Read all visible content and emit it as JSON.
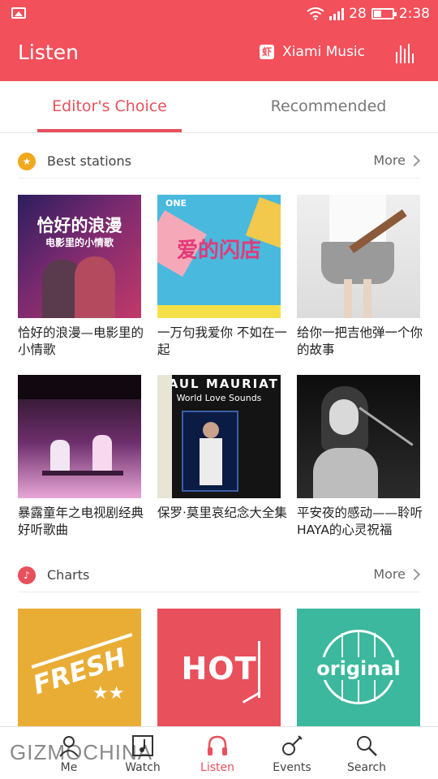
{
  "status_bar": {
    "signal_text": "28",
    "time": "2:38",
    "battery_level": 0.4
  },
  "header": {
    "title": "Listen",
    "provider_label": "Xiami Music",
    "provider_icon_text": "虾"
  },
  "tabs": [
    {
      "label": "Editor's Choice",
      "active": true
    },
    {
      "label": "Recommended",
      "active": false
    }
  ],
  "sections": {
    "stations": {
      "title": "Best stations",
      "more": "More"
    },
    "charts": {
      "title": "Charts",
      "more": "More"
    }
  },
  "stations": [
    {
      "title": "恰好的浪漫—电影里的小情歌",
      "cover_text": "恰好的浪漫",
      "cover_sub": "电影里的小情歌"
    },
    {
      "title": "一万句我爱你 不如在一起",
      "cover_text": "爱的闪店",
      "cover_sub": "ONE"
    },
    {
      "title": "给你一把吉他弹一个你的故事"
    },
    {
      "title": "暴露童年之电视剧经典好听歌曲"
    },
    {
      "title": "保罗·莫里哀纪念大全集",
      "cover_text": "PAUL MAURIAT",
      "cover_sub": "World Love Sounds"
    },
    {
      "title": "平安夜的感动——聆听HAYA的心灵祝福"
    }
  ],
  "charts": [
    {
      "label": "FRESH",
      "color": "#e9ad35"
    },
    {
      "label": "HOT",
      "color": "#e8505b"
    },
    {
      "label": "original",
      "color": "#3bb89d"
    }
  ],
  "bottom_nav": [
    {
      "label": "Me",
      "icon": "person-icon"
    },
    {
      "label": "Watch",
      "icon": "music-note-icon"
    },
    {
      "label": "Listen",
      "icon": "headphones-icon",
      "active": true
    },
    {
      "label": "Events",
      "icon": "guitar-icon"
    },
    {
      "label": "Search",
      "icon": "search-icon"
    }
  ],
  "watermark": "GIZMOCHINA",
  "colors": {
    "accent": "#f2505b",
    "tab_active": "#e8505b",
    "star_badge": "#f0a81c"
  }
}
